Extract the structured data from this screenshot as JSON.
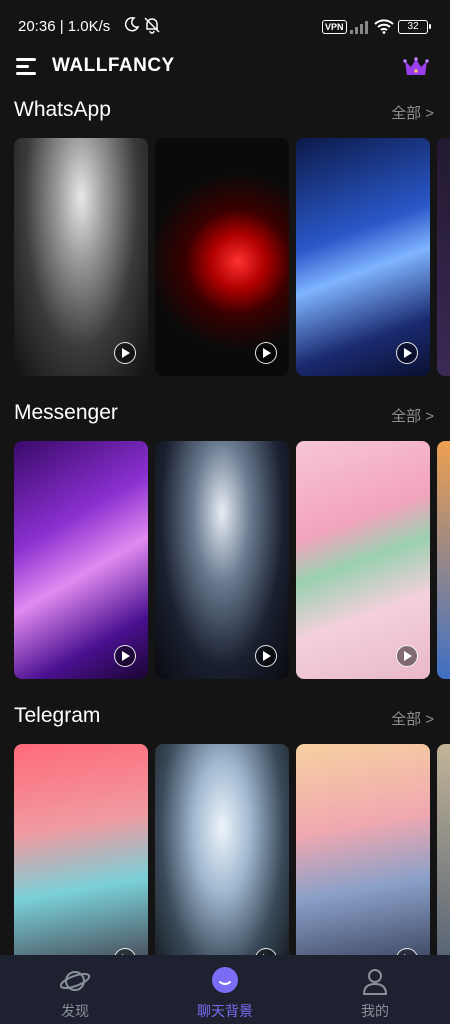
{
  "status_bar": {
    "time": "20:36 | 1.0K/s",
    "vpn": "VPN",
    "battery": "32"
  },
  "header": {
    "title": "WALLFANCY",
    "menu_icon": "menu-icon",
    "premium_icon": "crown-icon"
  },
  "sections": [
    {
      "title": "WhatsApp",
      "more": "全部 >"
    },
    {
      "title": "Messenger",
      "more": "全部 >"
    },
    {
      "title": "Telegram",
      "more": "全部 >"
    }
  ],
  "nav": {
    "items": [
      {
        "label": "发现",
        "icon": "planet-icon"
      },
      {
        "label": "聊天背景",
        "icon": "chat-icon"
      },
      {
        "label": "我的",
        "icon": "profile-icon"
      }
    ],
    "active_index": 1
  },
  "colors": {
    "background": "#141414",
    "accent": "#7b6cf6",
    "nav_background": "#1e2230",
    "crown": "#9b3df0"
  }
}
